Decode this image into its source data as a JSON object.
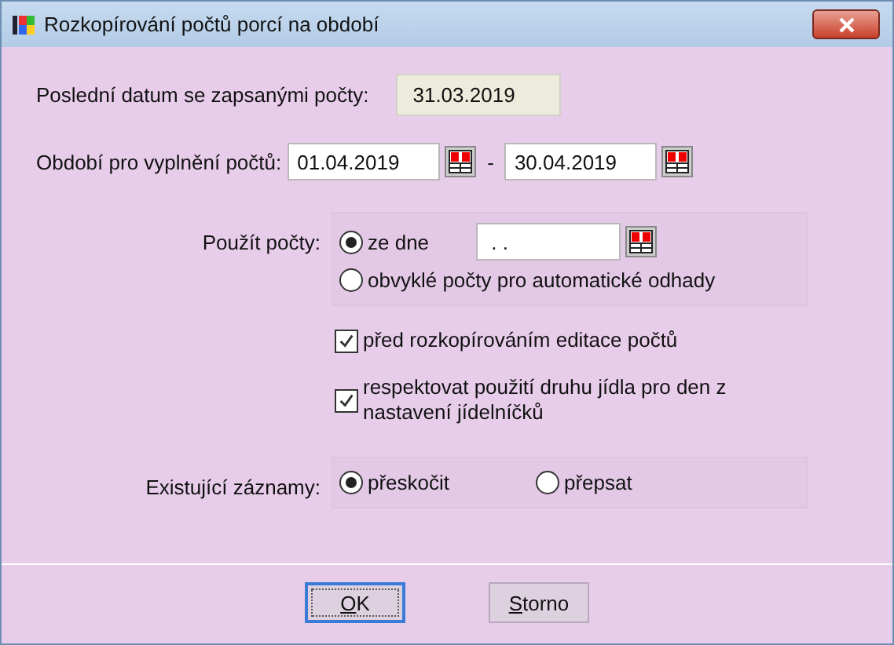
{
  "window": {
    "title": "Rozkopírování počtů porcí na období"
  },
  "last_date": {
    "label": "Poslední datum se zapsanými počty:",
    "value": "31.03.2019"
  },
  "period": {
    "label": "Období pro vyplnění počtů:",
    "from": "01.04.2019",
    "separator": "-",
    "to": "30.04.2019"
  },
  "use_counts": {
    "label": "Použít počty:",
    "options": [
      {
        "label": "ze dne",
        "selected": true,
        "date": " . ."
      },
      {
        "label": "obvyklé počty pro automatické odhady",
        "selected": false
      }
    ]
  },
  "checkboxes": [
    {
      "label": "před rozkopírováním editace počtů",
      "checked": true
    },
    {
      "label": "respektovat použití druhu jídla pro den z nastavení jídelníčků",
      "checked": true
    }
  ],
  "existing": {
    "label": "Existující záznamy:",
    "options": [
      {
        "label": "přeskočit",
        "selected": true
      },
      {
        "label": "přepsat",
        "selected": false
      }
    ]
  },
  "buttons": [
    {
      "label": "OK",
      "default": true
    },
    {
      "label": "Storno",
      "default": false
    }
  ]
}
